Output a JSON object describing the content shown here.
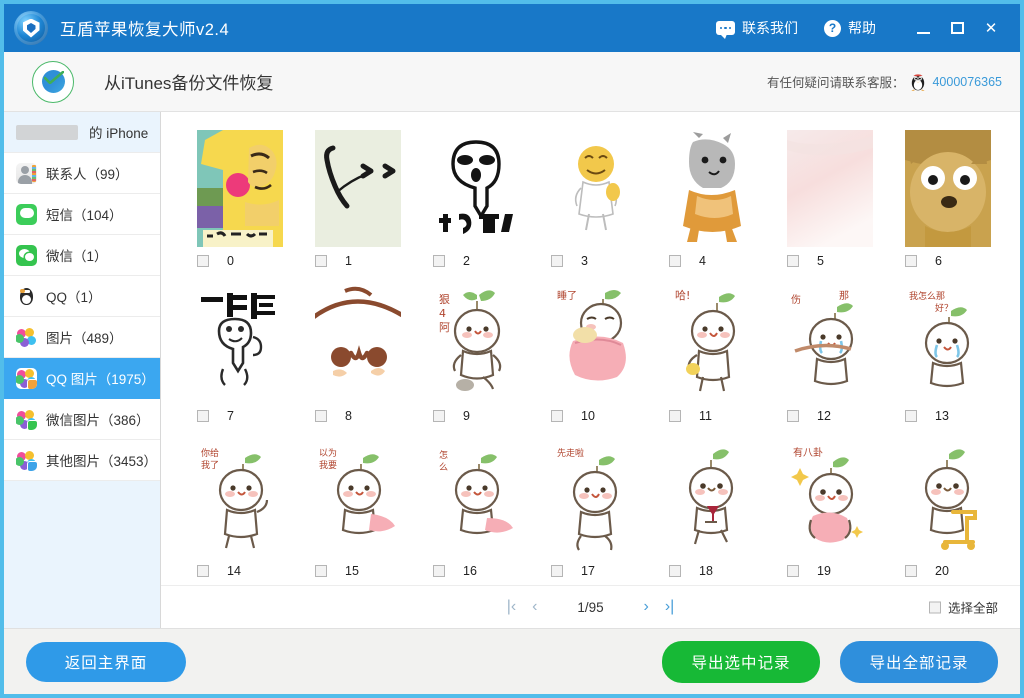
{
  "window": {
    "title": "互盾苹果恢复大师v2.4",
    "logo_icon": "shield-logo-icon",
    "contact_label": "联系我们",
    "contact_icon": "chat-bubble-icon",
    "help_label": "帮助",
    "help_icon": "question-mark-icon",
    "minimize_icon": "minimize-icon",
    "maximize_icon": "maximize-icon",
    "close_icon": "close-icon",
    "close_glyph": "✕",
    "titlebar_color": "#1878c8",
    "border_color": "#52bdea"
  },
  "subheader": {
    "badge_icon": "check-circle-icon",
    "title": "从iTunes备份文件恢复",
    "service_text": "有任何疑问请联系客服：",
    "service_icon": "qq-penguin-icon",
    "service_number": "4000076365",
    "service_number_color": "#3a9ad9"
  },
  "sidebar": {
    "device": {
      "name_redacted": true,
      "suffix": "的 iPhone"
    },
    "items": [
      {
        "label": "联系人（99）",
        "icon": "contacts-icon",
        "active": false
      },
      {
        "label": "短信（104）",
        "icon": "sms-icon",
        "active": false
      },
      {
        "label": "微信（1）",
        "icon": "wechat-icon",
        "active": false
      },
      {
        "label": "QQ（1）",
        "icon": "qq-icon",
        "active": false
      },
      {
        "label": "图片（489）",
        "icon": "photos-icon",
        "active": false
      },
      {
        "label": "QQ 图片（1975）",
        "icon": "qq-photos-icon",
        "active": true
      },
      {
        "label": "微信图片（386）",
        "icon": "wechat-photos-icon",
        "active": false
      },
      {
        "label": "其他图片（3453）",
        "icon": "other-photos-icon",
        "active": false
      }
    ],
    "active_color": "#3ba7f0"
  },
  "grid": {
    "items": [
      {
        "index": "0",
        "kind": "meme-yellow-face",
        "checked": false
      },
      {
        "index": "1",
        "kind": "meme-line-sketch",
        "checked": false
      },
      {
        "index": "2",
        "kind": "meme-doge-face-text",
        "checked": false
      },
      {
        "index": "3",
        "kind": "meme-smiley-body",
        "checked": false
      },
      {
        "index": "4",
        "kind": "meme-shiba-dog",
        "checked": false
      },
      {
        "index": "5",
        "kind": "meme-blank-pink",
        "checked": false
      },
      {
        "index": "6",
        "kind": "meme-doge-photo",
        "checked": false
      },
      {
        "index": "7",
        "kind": "meme-yilian-mengbi",
        "checked": false
      },
      {
        "index": "8",
        "kind": "sprout-face-closeup",
        "checked": false
      },
      {
        "index": "9",
        "kind": "sprout-walking",
        "checked": false
      },
      {
        "index": "10",
        "kind": "sprout-sleeping",
        "checked": false
      },
      {
        "index": "11",
        "kind": "sprout-holding-cup",
        "checked": false
      },
      {
        "index": "12",
        "kind": "sprout-crying",
        "checked": false
      },
      {
        "index": "13",
        "kind": "sprout-crying-two",
        "checked": false
      },
      {
        "index": "14",
        "kind": "sprout-waving",
        "checked": false
      },
      {
        "index": "15",
        "kind": "sprout-pink-scarf",
        "checked": false
      },
      {
        "index": "16",
        "kind": "sprout-pink-cloth",
        "checked": false
      },
      {
        "index": "17",
        "kind": "sprout-bowing",
        "checked": false
      },
      {
        "index": "18",
        "kind": "sprout-wine-glass",
        "checked": false
      },
      {
        "index": "19",
        "kind": "sprout-pink-heart",
        "checked": false
      },
      {
        "index": "20",
        "kind": "sprout-scooter",
        "checked": false
      }
    ]
  },
  "pager": {
    "first_glyph": "|‹",
    "prev_glyph": "‹",
    "label": "1/95",
    "next_glyph": "›",
    "last_glyph": "›|",
    "select_all_label": "选择全部",
    "select_all_checked": false
  },
  "footer": {
    "back_label": "返回主界面",
    "export_selected_label": "导出选中记录",
    "export_all_label": "导出全部记录",
    "export_selected_color": "#17b936",
    "export_all_color": "#2f8fdc"
  }
}
